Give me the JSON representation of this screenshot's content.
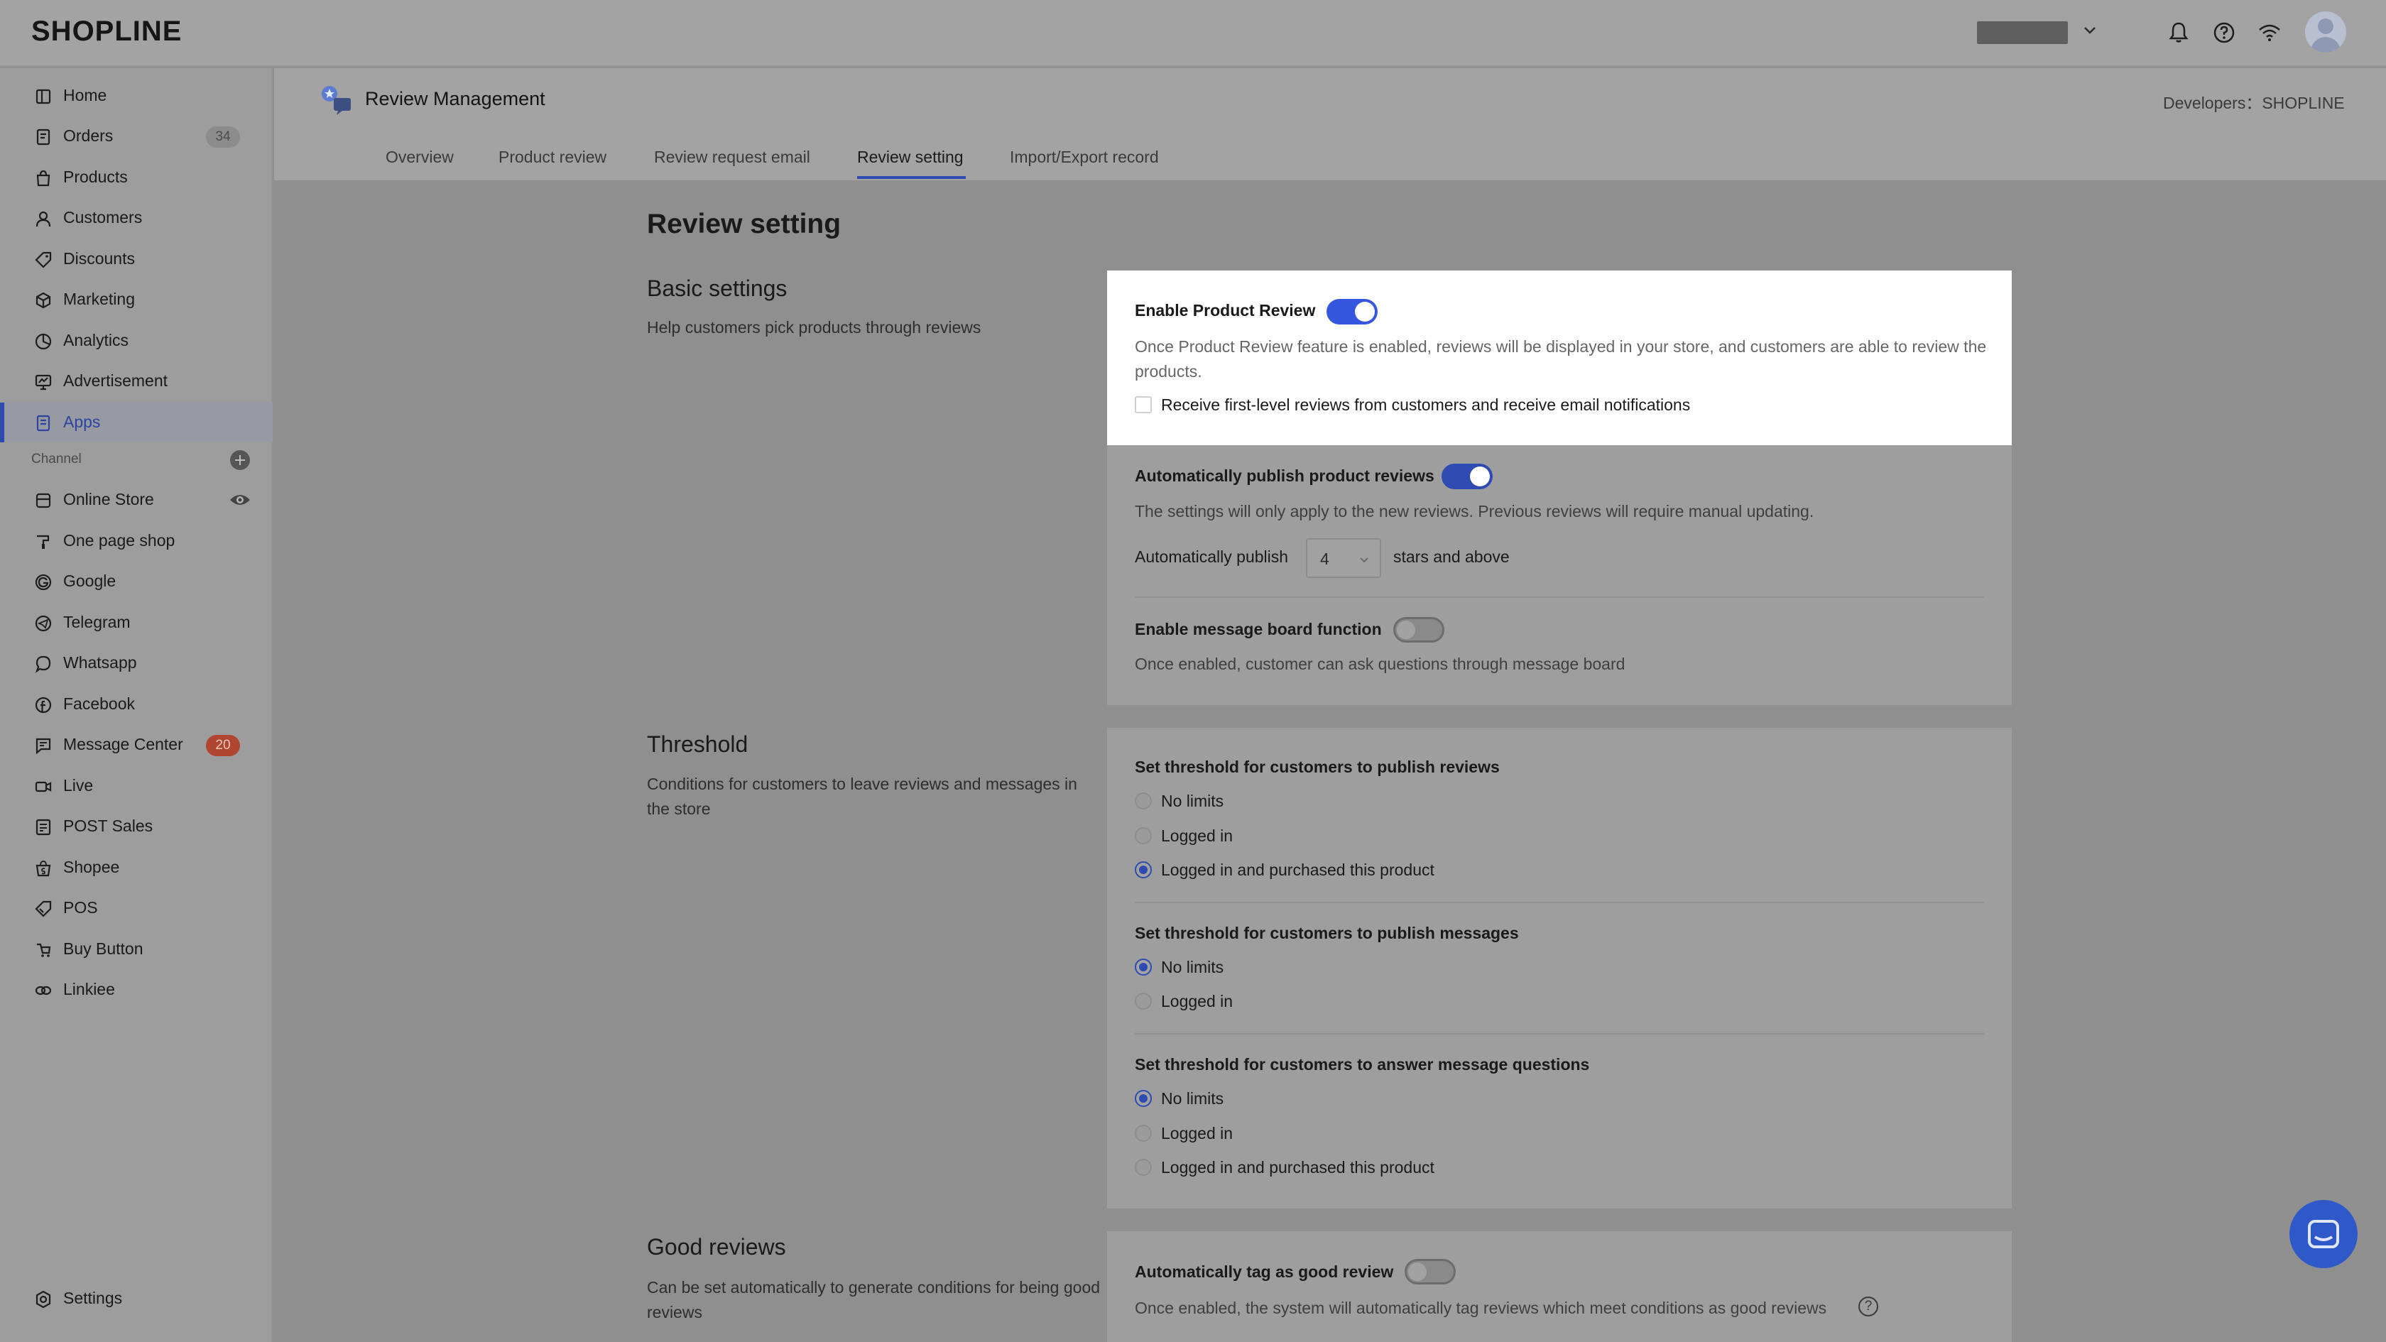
{
  "brand": {
    "logo": "SHOPLINE"
  },
  "header": {
    "store_name": ""
  },
  "sidebar": {
    "items": [
      {
        "label": "Home",
        "icon": "home-icon"
      },
      {
        "label": "Orders",
        "icon": "orders-icon",
        "badge": "34"
      },
      {
        "label": "Products",
        "icon": "bag-icon"
      },
      {
        "label": "Customers",
        "icon": "person-icon"
      },
      {
        "label": "Discounts",
        "icon": "tag-icon"
      },
      {
        "label": "Marketing",
        "icon": "marketing-icon"
      },
      {
        "label": "Analytics",
        "icon": "analytics-icon"
      },
      {
        "label": "Advertisement",
        "icon": "advertisement-icon"
      },
      {
        "label": "Apps",
        "icon": "apps-icon",
        "active": true
      }
    ],
    "channel_label": "Channel",
    "channels": [
      {
        "label": "Online Store",
        "icon": "store-icon"
      },
      {
        "label": "One page shop",
        "icon": "brush-icon"
      },
      {
        "label": "Google",
        "icon": "google-icon"
      },
      {
        "label": "Telegram",
        "icon": "telegram-icon"
      },
      {
        "label": "Whatsapp",
        "icon": "whatsapp-icon"
      },
      {
        "label": "Facebook",
        "icon": "facebook-icon"
      },
      {
        "label": "Message Center",
        "icon": "message-icon",
        "badge": "20"
      },
      {
        "label": "Live",
        "icon": "video-icon"
      },
      {
        "label": "POST Sales",
        "icon": "post-icon"
      },
      {
        "label": "Shopee",
        "icon": "shopee-icon"
      },
      {
        "label": "POS",
        "icon": "pos-icon"
      },
      {
        "label": "Buy Button",
        "icon": "buy-button-icon"
      },
      {
        "label": "Linkiee",
        "icon": "link-icon"
      }
    ],
    "settings": {
      "label": "Settings",
      "icon": "gear-icon"
    }
  },
  "page": {
    "app_title": "Review Management",
    "developers": "Developers：SHOPLINE",
    "tabs": [
      "Overview",
      "Product review",
      "Review request email",
      "Review setting",
      "Import/Export record"
    ],
    "selected_tab": "Review setting",
    "heading": "Review setting"
  },
  "basic": {
    "title": "Basic settings",
    "desc": "Help customers pick products through reviews",
    "enable_label": "Enable Product Review",
    "enable_desc": "Once Product Review feature is enabled, reviews will be displayed in your store, and customers are able to review the products.",
    "first_level_label": "Receive first-level reviews from customers and receive email notifications",
    "auto_publish_label": "Automatically publish product reviews",
    "auto_publish_desc": "The settings will only apply to the new reviews. Previous reviews will require manual updating.",
    "auto_publish_prefix": "Automatically publish",
    "stars_value": "4",
    "auto_publish_suffix": "stars and above",
    "board_label": "Enable message board function",
    "board_desc": "Once enabled, customer can ask questions through message board",
    "toggles": {
      "enable": true,
      "auto_publish": true,
      "message_board": false
    }
  },
  "threshold": {
    "title": "Threshold",
    "desc": "Conditions for customers to leave reviews and messages in the store",
    "groups": [
      {
        "label": "Set threshold for customers to publish reviews",
        "options": [
          "No limits",
          "Logged in",
          "Logged in and purchased this product"
        ],
        "selected": 2
      },
      {
        "label": "Set threshold for customers to publish messages",
        "options": [
          "No limits",
          "Logged in"
        ],
        "selected": 0
      },
      {
        "label": "Set threshold for customers to answer message questions",
        "options": [
          "No limits",
          "Logged in",
          "Logged in and purchased this product"
        ],
        "selected": 0
      }
    ]
  },
  "good": {
    "title": "Good reviews",
    "desc": "Can be set automatically to generate conditions for being good reviews",
    "auto_tag_label": "Automatically tag as good review",
    "auto_tag_desc": "Once enabled, the system will automatically tag reviews which meet conditions as good reviews",
    "toggle": false
  },
  "colors": {
    "accent": "#2d4bb0",
    "overlay": "#8f8f8f",
    "badge_red": "#b04530"
  }
}
